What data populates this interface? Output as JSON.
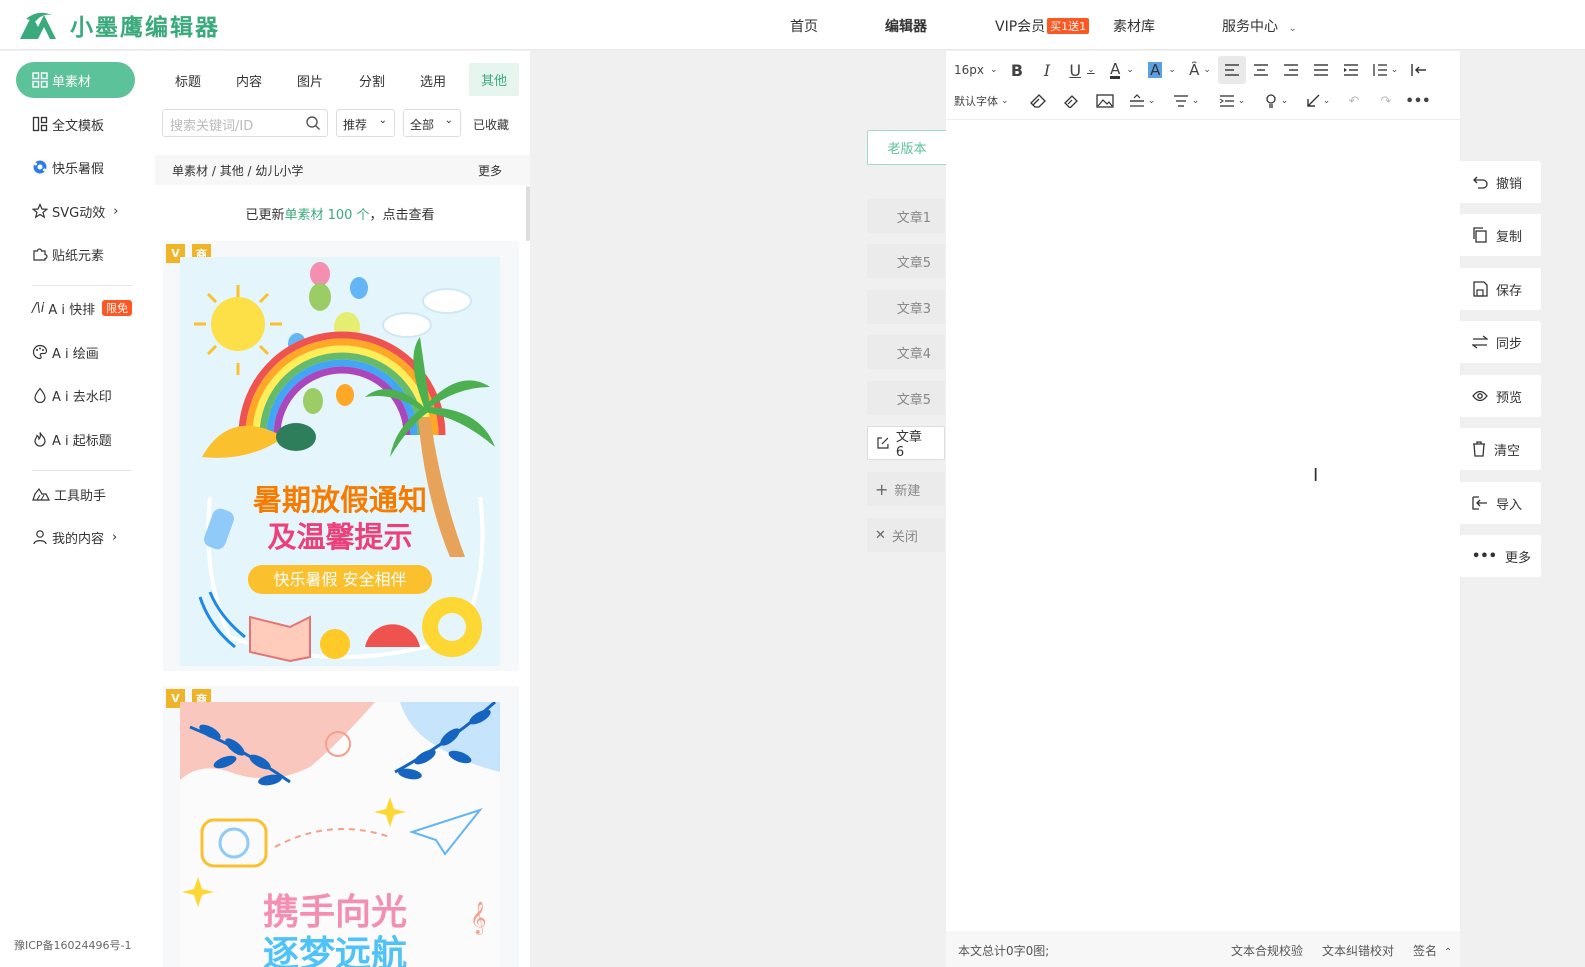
{
  "brand": {
    "name": "小墨鹰编辑器",
    "accent": "#3aaa7c",
    "accent_light": "#5cc29a"
  },
  "nav": [
    {
      "label": "首页"
    },
    {
      "label": "编辑器"
    },
    {
      "label": "VIP会员",
      "badge": "买1送1"
    },
    {
      "label": "素材库"
    },
    {
      "label": "服务中心"
    }
  ],
  "sidebar": {
    "items": [
      {
        "label": "单素材",
        "icon": "grid-icon"
      },
      {
        "label": "全文模板",
        "icon": "template-icon"
      },
      {
        "label": "快乐暑假",
        "icon": "ball-icon"
      },
      {
        "label": "SVG动效",
        "icon": "star-icon"
      },
      {
        "label": "贴纸元素",
        "icon": "puzzle-icon"
      },
      {
        "label": "A i 快排",
        "icon": "ai-icon",
        "badge": "限免"
      },
      {
        "label": "A i 绘画",
        "icon": "palette-icon"
      },
      {
        "label": "A i 去水印",
        "icon": "drop-icon"
      },
      {
        "label": "A i 起标题",
        "icon": "fire-icon"
      },
      {
        "label": "工具助手",
        "icon": "tools-icon"
      },
      {
        "label": "我的内容",
        "icon": "user-icon"
      }
    ],
    "icp": "豫ICP备16024496号-1"
  },
  "panel": {
    "tabs": [
      "标题",
      "内容",
      "图片",
      "分割",
      "选用",
      "其他"
    ],
    "search_placeholder": "搜索关键词/ID",
    "sort": "推荐",
    "filter": "全部",
    "favorites": "已收藏",
    "crumbs": [
      "单素材",
      "其他",
      "幼儿小学"
    ],
    "more": "更多",
    "notice": {
      "prefix": "已更新",
      "highlight": "单素材 100 个",
      "suffix": "，点击查看"
    },
    "cards": [
      {
        "tag_v": "V",
        "tag_shang": "商",
        "line1": "暑期放假通知",
        "line2": "及温馨提示",
        "ribbon": "快乐暑假 安全相伴"
      },
      {
        "tag_v": "V",
        "tag_shang": "商",
        "line1": "携手向光",
        "line2": "逐梦远航"
      }
    ]
  },
  "articles": {
    "old_version": "老版本",
    "items": [
      "文章1",
      "文章5",
      "文章3",
      "文章4",
      "文章5",
      "文章6"
    ],
    "new": "新建",
    "close": "关闭"
  },
  "editor": {
    "font_size": "16px",
    "font_family": "默认字体",
    "status_text": "本文总计0字0图;",
    "check1": "文本合规校验",
    "check2": "文本纠错校对",
    "signature": "签名"
  },
  "right_actions": [
    "撤销",
    "复制",
    "保存",
    "同步",
    "预览",
    "清空",
    "导入",
    "更多"
  ]
}
